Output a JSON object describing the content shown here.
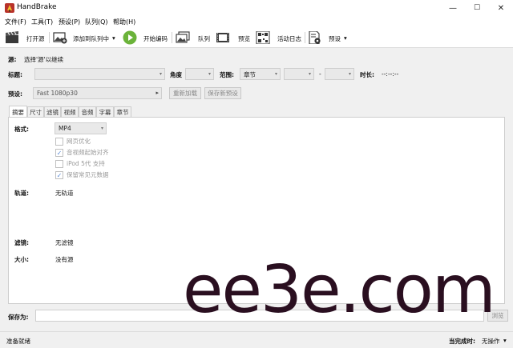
{
  "window": {
    "title": "HandBrake",
    "controls": {
      "minimize": "—",
      "maximize": "☐",
      "close": "✕"
    }
  },
  "menu": [
    "文件(F)",
    "工具(T)",
    "预设(P)",
    "队列(Q)",
    "帮助(H)"
  ],
  "toolbar": {
    "open_source": "打开源",
    "add_to_queue": "添加到队列中",
    "start_encode": "开始编码",
    "queue": "队列",
    "preview": "预览",
    "activity_log": "活动日志",
    "presets": "预设",
    "dropdown_glyph": "▾",
    "play_color": "#6bb33a"
  },
  "source": {
    "label": "源:",
    "value": "选择'源'以继续"
  },
  "title_row": {
    "title_label": "标题:",
    "angle_label": "角度",
    "range_label": "范围:",
    "range_value": "章节",
    "dash": "-",
    "duration_label": "时长:",
    "duration_value": "--:--:--"
  },
  "preset_row": {
    "label": "预设:",
    "value": "Fast 1080p30",
    "arrow": "▸",
    "reload_button": "重新加载",
    "save_new_button": "保存新预设"
  },
  "tabs": [
    "摘要",
    "尺寸",
    "滤镜",
    "视频",
    "音频",
    "字幕",
    "章节"
  ],
  "summary": {
    "format_label": "格式:",
    "format_value": "MP4",
    "options": [
      {
        "label": "网页优化",
        "checked": false
      },
      {
        "label": "音视频起始对齐",
        "checked": true
      },
      {
        "label": "iPod 5代 支持",
        "checked": false
      },
      {
        "label": "保留常见元数据",
        "checked": true
      }
    ],
    "tracks_label": "轨道:",
    "tracks_value": "无轨道",
    "filters_label": "滤镜:",
    "filters_value": "无滤镜",
    "size_label": "大小:",
    "size_value": "没有源"
  },
  "save_as": {
    "label": "保存为:",
    "browse_button": "浏览"
  },
  "status": {
    "ready": "准备就绪",
    "when_done_label": "当完成时:",
    "when_done_value": "无操作",
    "dropdown_glyph": "▾"
  },
  "watermark": "ee3e.com"
}
